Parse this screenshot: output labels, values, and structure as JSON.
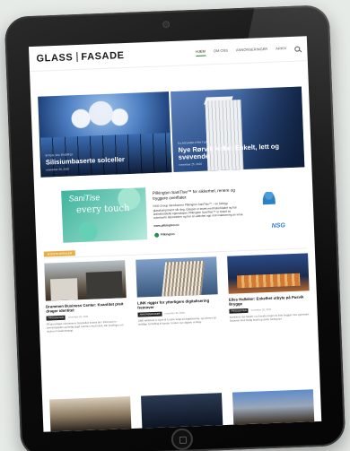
{
  "header": {
    "logo_left": "GLASS",
    "logo_right": "FASADE",
    "nav": [
      "HJEM",
      "OM OSS",
      "ANNONSERINGER",
      "ARKIV"
    ]
  },
  "hero": [
    {
      "tag": "BYGG OG ENERGI",
      "title": "Silisiumbaserte solceller",
      "date": "november 20, 2020"
    },
    {
      "tag": "GLASSARKITEKTUR",
      "title": "Nye Rørvik kirke: Enkelt, lett og svevende",
      "date": "november 25, 2020"
    }
  ],
  "ad": {
    "brand": "SaniTise",
    "slogan": "every touch",
    "headline": "Pilkington SaniTise™ for sikkerhet, renere og tryggere overflater.",
    "body": "NSG Group introduserer Pilkington SaniTise™ – en belegg glasskomponent når deg. Glasset er testet med listerbladet og har antimikrobielle egenskaper. Pilkington SaniTise™ er testet av autoriserte laboratorier og har en aktivitet opp mot inaktivering av virus.",
    "link": "www.pilkington.no",
    "partner": "Pilkington",
    "logo": "NSG"
  },
  "section_label": "NYESTE ARTIKLER",
  "articles": [
    {
      "title": "Drammen Business Center: Kvantitet preit drager identitet",
      "badge": "PROSJEKTER",
      "date": "november 26, 2020",
      "excerpt": "På grunnlaget i Drammens Sorgnellas kvartal ble i tråd med en forretningsplan og ferdig bygd sammen med hotell, alle fordringer om skolens Fasadestrategi."
    },
    {
      "title": "LINK rigger for ytterligere digitalisering fremover",
      "badge": "ANNONSERINGER",
      "date": "november 26, 2020",
      "excerpt": "LINK arkitektur er klare til å satse tungt på digitalisering, og nyheter på skriftlige formidling til kunder, foruten nye digitale verktøy."
    },
    {
      "title": "Elles Hallaker: Enkelhet utbyte på Pasvik Brygge",
      "badge": "PROSJEKTER",
      "date": "november 20, 2020",
      "excerpt": "Kantinens nye lokaler i ny fasade preget av lette brygger mot sjøarealet. Sammen med ferdig hotell og andre funksjoner."
    }
  ]
}
